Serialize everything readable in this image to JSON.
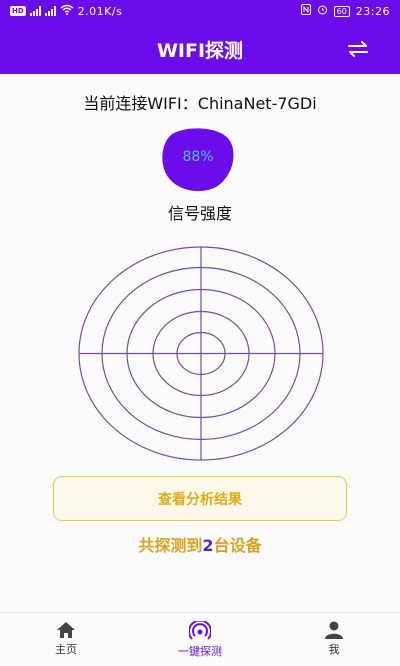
{
  "status_bar": {
    "hd": "HD",
    "network_left": "4G",
    "network_right": "3G",
    "speed": "2.01K/s",
    "battery": "60",
    "time": "23:26"
  },
  "app_bar": {
    "title": "WIFI探测",
    "swap_icon": "swap-arrows-icon"
  },
  "main": {
    "current_wifi_label": "当前连接WIFI：ChinaNet-7GDi",
    "signal_percent": "88%",
    "signal_label": "信号强度",
    "result_button": "查看分析结果",
    "count_prefix": "共探测到",
    "count_value": "2",
    "count_suffix": "台设备"
  },
  "tabs": [
    {
      "label": "主页",
      "icon": "home-icon"
    },
    {
      "label": "一键探测",
      "icon": "radar-signal-icon"
    },
    {
      "label": "我",
      "icon": "person-icon"
    }
  ],
  "colors": {
    "primary": "#6a0dea",
    "gold": "#e0ad17",
    "percent_text": "#49c5ff"
  }
}
